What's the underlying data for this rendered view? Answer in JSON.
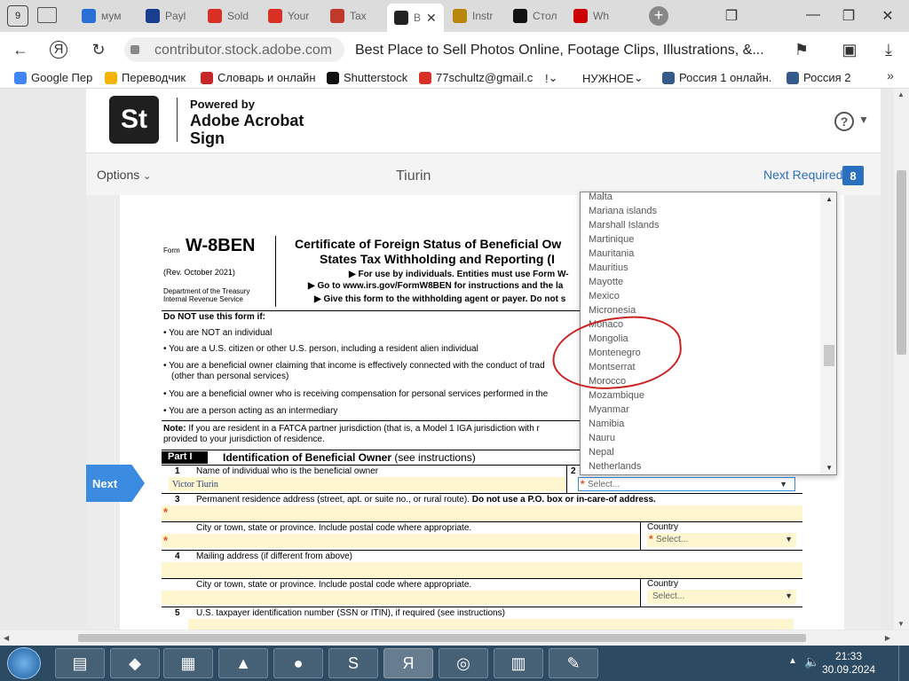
{
  "browser": {
    "tabs": [
      {
        "label": "мум",
        "icon": "pause-icon",
        "color": "#2a6fd6"
      },
      {
        "label": "Payl",
        "icon": "paypal-icon",
        "color": "#1a3d8f"
      },
      {
        "label": "Sold",
        "icon": "gmail-icon",
        "color": "#d93025"
      },
      {
        "label": "Your",
        "icon": "gmail-icon",
        "color": "#d93025"
      },
      {
        "label": "Tax",
        "icon": "app-icon",
        "color": "#c0392b"
      },
      {
        "label": "B",
        "icon": "st-icon",
        "color": "#222222"
      },
      {
        "label": "Instr",
        "icon": "doc-icon",
        "color": "#b8860b"
      },
      {
        "label": "Стол",
        "icon": "tiktok-icon",
        "color": "#111111"
      },
      {
        "label": "Wh",
        "icon": "adobe-icon",
        "color": "#cc0000"
      }
    ],
    "tab_counter": "9",
    "url": "contributor.stock.adobe.com",
    "page_title": "Best Place to Sell Photos Online, Footage Clips, Illustrations, &...",
    "bookmarks": [
      {
        "label": "Google Пер",
        "color": "#4285f4"
      },
      {
        "label": "Переводчик",
        "color": "#f4b400"
      },
      {
        "label": "Словарь и онлайн",
        "color": "#c62828"
      },
      {
        "label": "Shutterstock",
        "color": "#111111"
      },
      {
        "label": "77schultz@gmail.c",
        "color": "#d93025"
      },
      {
        "label": "!",
        "color": ""
      },
      {
        "label": "НУЖНОЕ",
        "color": ""
      },
      {
        "label": "Россия 1 онлайн.",
        "color": "#355a8a"
      },
      {
        "label": "Россия 2",
        "color": "#355a8a"
      }
    ]
  },
  "sign": {
    "logo": "St",
    "powered_by": "Powered by",
    "brand": "Adobe Acrobat Sign",
    "options": "Options",
    "signer": "Tiurin",
    "next_required": "Next Required",
    "badge": "8",
    "next_tab": "Next"
  },
  "form": {
    "form_label": "Form",
    "form_number": "W-8BEN",
    "rev": "(Rev. October 2021)",
    "dept1": "Department of the Treasury",
    "dept2": "Internal Revenue Service",
    "title1": "Certificate of Foreign Status of Beneficial Ow",
    "title2": "States Tax Withholding and Reporting (I",
    "instr1": "▶ For use by individuals. Entities must use Form W-",
    "instr2": "▶ Go to www.irs.gov/FormW8BEN for instructions and the la",
    "instr3": "▶ Give this form to the withholding agent or payer. Do not s",
    "do_not_use": "Do NOT use this form if:",
    "bullets": [
      "• You are NOT an individual",
      "• You are a U.S. citizen or other U.S. person, including a resident alien individual",
      "• You are a beneficial owner claiming that income is effectively connected with the conduct of trad",
      "(other than personal services)",
      "• You are a beneficial owner who is receiving compensation for personal services performed in the",
      "• You are a person acting as an intermediary"
    ],
    "note_bold": "Note:",
    "note1": " If you are resident in a FATCA partner jurisdiction (that is, a Model 1 IGA jurisdiction with r",
    "note2": "provided to your jurisdiction of residence.",
    "part": "Part I",
    "part_title": "Identification of Beneficial Owner",
    "part_sub": " (see instructions)",
    "l1_num": "1",
    "l1": "Name of individual who is the beneficial owner",
    "l1_val": "Victor Tiurin",
    "l2_num": "2",
    "l3_num": "3",
    "l3": "Permanent residence address (street, apt. or suite no., or rural route).",
    "l3_bold": " Do not use a P.O. box or in-care-of address.",
    "city": "City or town, state or province. Include postal code where appropriate.",
    "country": "Country",
    "select": "Select...",
    "l4_num": "4",
    "l4": "Mailing address (if different from above)",
    "l5_num": "5",
    "l5": "U.S. taxpayer identification number (SSN or ITIN), if required (see instructions)"
  },
  "dropdown": {
    "options": [
      "Malta",
      "Mariana islands",
      "Marshall Islands",
      "Martinique",
      "Mauritania",
      "Mauritius",
      "Mayotte",
      "Mexico",
      "Micronesia",
      "Monaco",
      "Mongolia",
      "Montenegro",
      "Montserrat",
      "Morocco",
      "Mozambique",
      "Myanmar",
      "Namibia",
      "Nauru",
      "Nepal",
      "Netherlands"
    ]
  },
  "taskbar": {
    "time": "21:33",
    "date": "30.09.2024"
  }
}
